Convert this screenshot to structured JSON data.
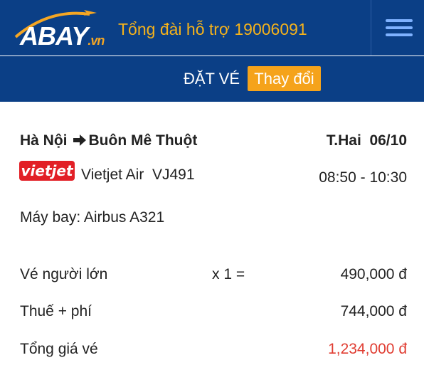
{
  "header": {
    "logo": {
      "main": "BAY",
      "suffix": ".vn",
      "prefix": "A"
    },
    "hotline": "Tổng đài hỗ trợ 19006091",
    "menu_icon": "hamburger-icon"
  },
  "subheader": {
    "book_label": "ĐẶT VÉ",
    "change_button": "Thay đổi"
  },
  "flight": {
    "origin": "Hà Nội",
    "destination": "Buôn Mê Thuột",
    "arrow_icon": "arrow-right-icon",
    "date": "T.Hai  06/10",
    "airline_logo_text": "vietjet",
    "airline": "Vietjet Air  VJ491",
    "time": "08:50 - 10:30",
    "aircraft": "Máy bay: Airbus A321"
  },
  "pricing": {
    "adult": {
      "label": "Vé người lớn",
      "multiplier": "x 1 =",
      "value": "490,000 đ"
    },
    "tax": {
      "label": "Thuế + phí",
      "value": "744,000 đ"
    },
    "total": {
      "label": "Tổng giá vé",
      "value": "1,234,000 đ"
    }
  },
  "colors": {
    "header_bg": "#0b3f86",
    "accent": "#f5a31b",
    "total_red": "#e03c31",
    "vietjet_red": "#e21f26"
  }
}
